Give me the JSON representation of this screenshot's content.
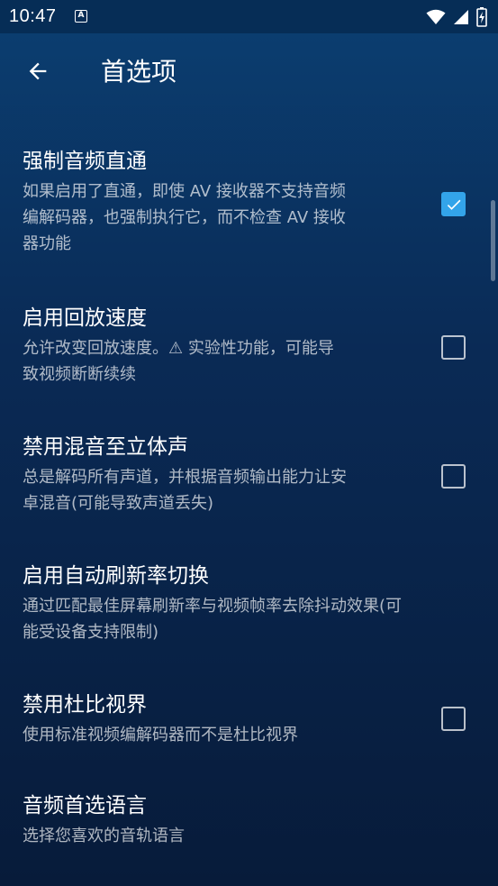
{
  "status_bar": {
    "time": "10:47",
    "icons": [
      "notification-a-icon",
      "wifi-icon",
      "cellular-signal-icon",
      "battery-charging-icon"
    ]
  },
  "app_bar": {
    "back_icon": "arrow-back-icon",
    "title": "首选项"
  },
  "colors": {
    "checkbox_checked": "#33a4ea",
    "background_top": "#0b3f72",
    "background_bottom": "#071b3a"
  },
  "preferences": [
    {
      "title": "强制音频直通",
      "summary": "如果启用了直通，即使 AV 接收器不支持音频\n编解码器，也强制执行它，而不检查 AV 接收\n器功能",
      "checkbox": true,
      "checked": true
    },
    {
      "title": "启用回放速度",
      "summary": "允许改变回放速度。⚠ 实验性功能，可能导\n致视频断断续续",
      "checkbox": true,
      "checked": false
    },
    {
      "title": "禁用混音至立体声",
      "summary": "总是解码所有声道，并根据音频输出能力让安\n卓混音(可能导致声道丢失)",
      "checkbox": true,
      "checked": false
    },
    {
      "title": "启用自动刷新率切换",
      "summary": "通过匹配最佳屏幕刷新率与视频帧率去除抖动效果(可\n能受设备支持限制)",
      "checkbox": false,
      "checked": false
    },
    {
      "title": "禁用杜比视界",
      "summary": "使用标准视频编解码器而不是杜比视界",
      "checkbox": true,
      "checked": false
    },
    {
      "title": "音频首选语言",
      "summary": "选择您喜欢的音轨语言",
      "checkbox": false,
      "checked": false
    }
  ]
}
